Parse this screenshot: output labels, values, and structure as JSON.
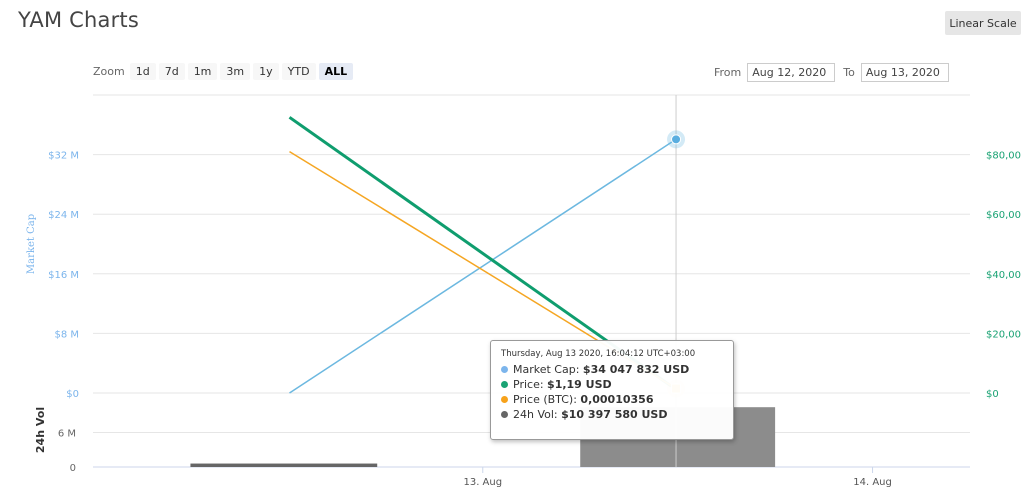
{
  "header": {
    "title": "YAM Charts",
    "scale_button": "Linear Scale"
  },
  "zoom": {
    "label": "Zoom",
    "buttons": [
      "1d",
      "7d",
      "1m",
      "3m",
      "1y",
      "YTD",
      "ALL"
    ],
    "active": "ALL"
  },
  "range": {
    "from_label": "From",
    "from_value": "Aug 12, 2020",
    "to_label": "To",
    "to_value": "Aug 13, 2020"
  },
  "tooltip": {
    "date": "Thursday, Aug 13 2020, 16:04:12 UTC+03:00",
    "items": [
      {
        "label": "Market Cap: ",
        "value": "$34 047 832 USD",
        "color": "#7cb5ec"
      },
      {
        "label": "Price: ",
        "value": "$1,19 USD",
        "color": "#1aa374"
      },
      {
        "label": "Price (BTC): ",
        "value": "0,00010356",
        "color": "#f7a21b"
      },
      {
        "label": "24h Vol: ",
        "value": "$10 397 580 USD",
        "color": "#666666"
      }
    ]
  },
  "chart_data": {
    "type": "line",
    "x_ticks": [
      {
        "label": "13. Aug",
        "t": 24
      },
      {
        "label": "14. Aug",
        "t": 48
      }
    ],
    "x_range": [
      0,
      54
    ],
    "market_cap_axis": {
      "title": "Market Cap",
      "ticks": [
        "$0",
        "$8 M",
        "$16 M",
        "$24 M",
        "$32 M"
      ],
      "tick_values": [
        0,
        8,
        16,
        24,
        32
      ],
      "range": [
        0,
        40
      ],
      "color": "#7cb5ec"
    },
    "price_axis": {
      "ticks": [
        "$0",
        "$20,00",
        "$40,00",
        "$60,00",
        "$80,00"
      ],
      "tick_values": [
        0,
        20,
        40,
        60,
        80
      ],
      "range": [
        0,
        100
      ],
      "color": "#1aa374"
    },
    "volume_axis": {
      "title": "24h Vol",
      "ticks": [
        "0",
        "6 M"
      ],
      "tick_values": [
        0,
        6
      ],
      "range": [
        0,
        12
      ]
    },
    "series": [
      {
        "name": "Market Cap",
        "axis": "market_cap",
        "color": "#6cb8e0",
        "width": 1.5,
        "points": [
          [
            12.1,
            0
          ],
          [
            35.9,
            34.05
          ]
        ]
      },
      {
        "name": "Price",
        "axis": "price",
        "color": "#0f9d6e",
        "width": 3,
        "points": [
          [
            12.1,
            92.5
          ],
          [
            35.9,
            1.19
          ]
        ]
      },
      {
        "name": "Price (BTC)",
        "axis": "price",
        "color": "#f5a623",
        "width": 1.5,
        "points": [
          [
            12.1,
            81.0
          ],
          [
            35.9,
            1.5
          ]
        ]
      }
    ],
    "volume_bars": [
      {
        "t_start": 6,
        "t_end": 17.5,
        "value": 0.6
      },
      {
        "t_start": 30,
        "t_end": 42,
        "value": 10.4
      }
    ],
    "crosshair_t": 35.9,
    "grid": true
  }
}
